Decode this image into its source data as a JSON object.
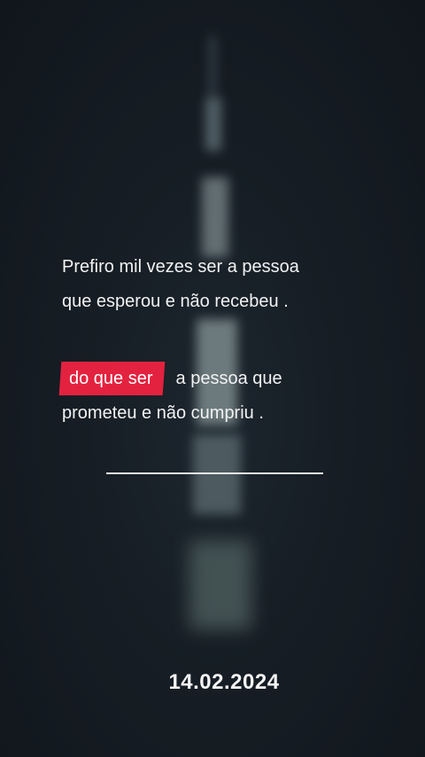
{
  "quote": {
    "line1": "Prefiro mil vezes ser a pessoa",
    "line2": "que esperou e não recebeu  .",
    "highlight": "do que ser",
    "line3_rest": "a pessoa que",
    "line4": "prometeu e não cumpriu ."
  },
  "date": "14.02.2024",
  "colors": {
    "background": "#141b22",
    "highlight": "#e3223f",
    "text": "#f2f2f2"
  }
}
